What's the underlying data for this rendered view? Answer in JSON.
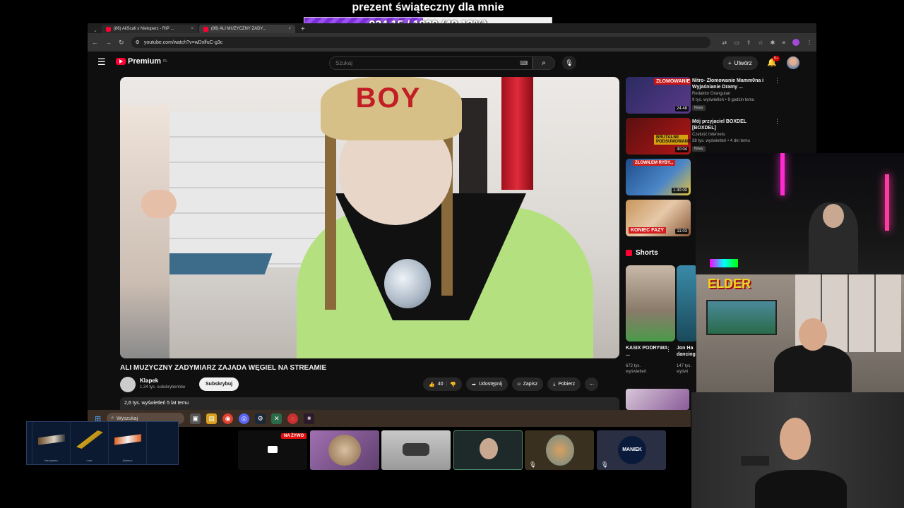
{
  "goal": {
    "title": "prezent świąteczny dla mnie",
    "progress_text": "924.15 / 1920 (48.13%)",
    "progress_fraction": 0.4813
  },
  "browser": {
    "tabs": [
      {
        "label": "(86) AliScali x Nietoperz - RIP ..."
      },
      {
        "label": "(86) ALI MUZYCZNY ZADY..."
      }
    ],
    "url": "youtube.com/watch?v=wDxlfuC-g3c"
  },
  "yt": {
    "logo_text": "Premium",
    "logo_region": "PL",
    "search_placeholder": "Szukaj",
    "create_label": "Utwórz",
    "notif_count": "9+"
  },
  "video": {
    "hat_text": "BOY",
    "title": "ALI MUZYCZNY ZADYMIARZ ZAJADA WĘGIEL NA STREAMIE",
    "channel": "Klapek",
    "subs": "1,34 tys. subskrybentów",
    "subscribe_label": "Subskrybuj",
    "likes": "40",
    "share_label": "Udostępnij",
    "save_label": "Zapisz",
    "download_label": "Pobierz",
    "desc_meta": "2,6 tys. wyświetleń  5 lat temu"
  },
  "recommendations": [
    {
      "title": "Nitro- Złomowanie Mamm0na i Wyjaśnianie Dramy ...",
      "channel": "Redaktor Orangutan",
      "meta": "9 tys. wyświetleń • 9 godzin temu",
      "badge": "Nowy",
      "duration": "24:48",
      "thumb_text": "ZŁOMOWANIE",
      "color": "#3a3a7a"
    },
    {
      "title": "Mój przyjaciel BOXDEL [BOXDEL]",
      "channel": "Czeluść Internetu",
      "meta": "38 tys. wyświetleń • 4 dni temu",
      "badge": "Nowy",
      "duration": "30:04",
      "thumb_text": "BRUTALNE PODSUMOWANIE",
      "color": "#8a1010"
    },
    {
      "title": "",
      "channel": "",
      "meta": "",
      "badge": "",
      "duration": "1:30:00",
      "thumb_text": "ZŁOWIŁEM RYBY...",
      "color": "#2a5a9a"
    },
    {
      "title": "",
      "channel": "",
      "meta": "",
      "badge": "",
      "duration": "11:03",
      "thumb_text": "KONIEC FAZY",
      "color": "#c88a4a"
    }
  ],
  "shorts": {
    "heading": "Shorts",
    "items": [
      {
        "title": "KASIX PODRYWA ...",
        "meta": "672 tys. wyświetleń"
      },
      {
        "title": "Jon Ha dancing",
        "meta": "147 tys. wyświ"
      }
    ]
  },
  "overlay": {
    "elder_logo": "ELDER"
  },
  "taskbar": {
    "search_label": "Wyszukaj"
  },
  "skins": [
    {
      "name": ""
    },
    {
      "name": "Neoqueen"
    },
    {
      "name": "Lore"
    },
    {
      "name": "Asiimov"
    }
  ],
  "viewers": {
    "live_label": "NA ŻYWO",
    "tile_label": "MANIEK"
  }
}
